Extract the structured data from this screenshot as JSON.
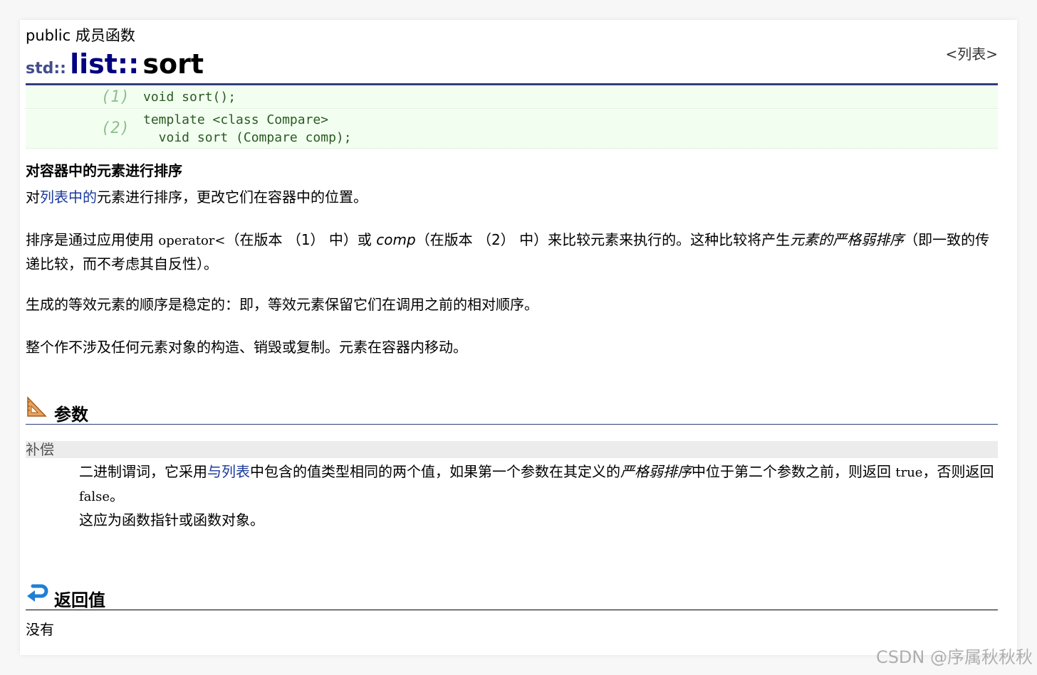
{
  "header": {
    "member_type": "public 成员函数",
    "namespace": "std::",
    "class_name": "list::",
    "function_name": "sort",
    "context_link": "<列表>"
  },
  "prototypes": [
    {
      "num": "(1)",
      "code": "void sort();"
    },
    {
      "num": "(2)",
      "code": "template <class Compare>\n  void sort (Compare comp);"
    }
  ],
  "summary": "对容器中的元素进行排序",
  "paragraphs": {
    "p1": {
      "pre": "对",
      "link": "列表中的",
      "post": "元素进行排序，更改它们在容器中的位置。"
    },
    "p2": {
      "a": "排序是通过应用使用 ",
      "code": "operator<",
      "b": "（在版本 （1） 中）或 ",
      "comp": "comp",
      "c": "（在版本 （2） 中）来比较元素来执行的。这种比较将产生",
      "em": "元素的严格弱排序",
      "d": "（即一致的传递比较，而不考虑其自反性）。"
    },
    "p3": "生成的等效元素的顺序是稳定的：即，等效元素保留它们在调用之前的相对顺序。",
    "p4": "整个作不涉及任何元素对象的构造、销毁或复制。元素在容器内移动。"
  },
  "params_section": {
    "title": "参数",
    "param_name": "补偿",
    "desc": {
      "a": "二进制谓词，它采用",
      "link": "与列表",
      "b": "中包含的值类型相同的两个值，如果第一个参数在其定义的",
      "em": "严格弱排序",
      "c": "中位于第二个参数之前，则返回 ",
      "true_code": "true",
      "d": "，否则返回 ",
      "false_code": "false",
      "e": "。",
      "line2": "这应为函数指针或函数对象。"
    }
  },
  "return_section": {
    "title": "返回值",
    "value": "没有"
  },
  "watermark": "CSDN @序属秋秋秋",
  "colors": {
    "class_name": "#000080",
    "namespace": "#444c8c",
    "link": "#1a3a9c",
    "proto_bg": "#f2fff0",
    "rule": "#2f3f7a"
  },
  "icons": {
    "params": "ruler-triangle-icon",
    "return": "return-arrow-icon"
  }
}
